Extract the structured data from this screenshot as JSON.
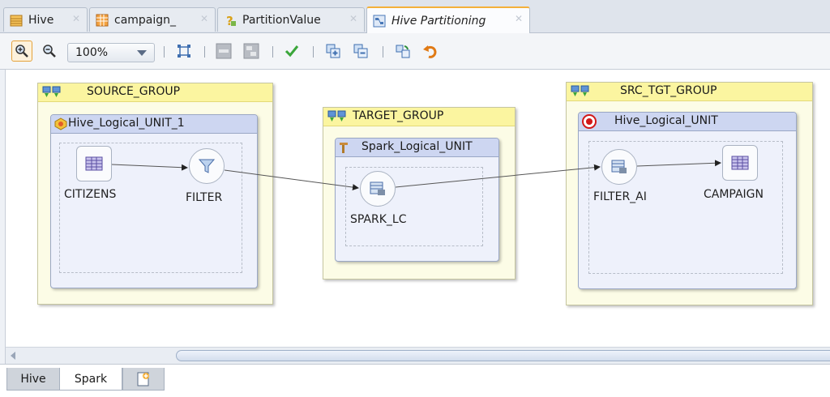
{
  "tabs": [
    {
      "label": "Hive",
      "icon": "table-list-icon"
    },
    {
      "label": "campaign_",
      "icon": "datastore-grid-icon"
    },
    {
      "label": "PartitionValue",
      "icon": "variable-icon"
    },
    {
      "label": "Hive Partitioning",
      "icon": "mapping-icon"
    }
  ],
  "toolbar": {
    "zoom_value": "100%",
    "buttons": [
      "zoom-in-icon",
      "zoom-out-icon",
      "fit-to-page-icon",
      "collapse-icon",
      "expand-icon",
      "validate-icon",
      "add-icon",
      "remove-icon",
      "refresh-icon",
      "undo-icon"
    ]
  },
  "groups": [
    {
      "name": "SOURCE_GROUP",
      "unit": "Hive_Logical_UNIT_1",
      "nodes": [
        "CITIZENS",
        "FILTER"
      ]
    },
    {
      "name": "TARGET_GROUP",
      "unit": "Spark_Logical_UNIT",
      "nodes": [
        "SPARK_LC"
      ]
    },
    {
      "name": "SRC_TGT_GROUP",
      "unit": "Hive_Logical_UNIT",
      "nodes": [
        "FILTER_AI",
        "CAMPAIGN"
      ]
    }
  ],
  "bottom_tabs": [
    "Hive",
    "Spark"
  ],
  "colors": {
    "group_header": "#fbf5a0",
    "unit_header": "#cdd6f1",
    "active_tab_accent": "#f4b03a"
  }
}
